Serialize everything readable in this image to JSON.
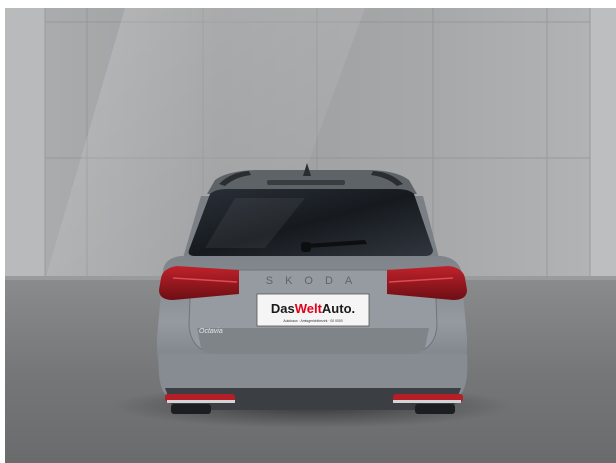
{
  "photo": {
    "description_alt": "",
    "vehicle": {
      "badge_text": "SKODA",
      "model_script": "Octavia",
      "plate": {
        "prefix": "Das",
        "highlight": "Welt",
        "suffix": "Auto.",
        "small_print": "Autohaus · Amtsgerichtbezirk · 00 0000"
      }
    },
    "colors": {
      "wall": "#a3a4a5",
      "floor": "#7c7d7e",
      "body": "#8b9195",
      "glass": "#1b1f24",
      "taillight": "#a5161f",
      "plate_highlight": "#e2001a"
    }
  }
}
